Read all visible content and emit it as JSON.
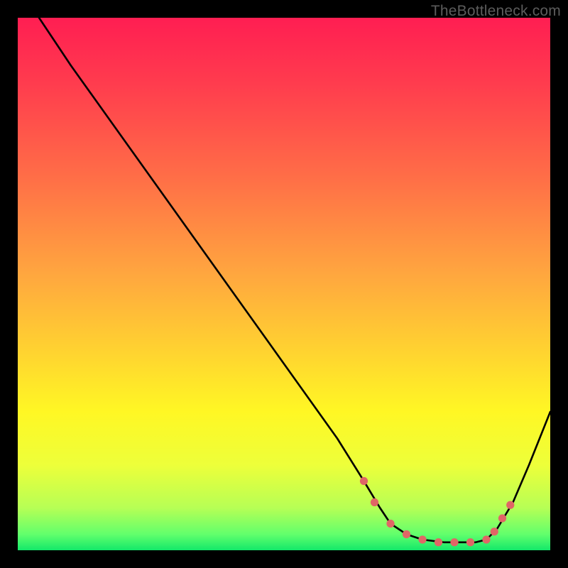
{
  "watermark": "TheBottleneck.com",
  "gradient_stops": [
    {
      "offset": "0%",
      "color": "#ff1e52"
    },
    {
      "offset": "12%",
      "color": "#ff3b4e"
    },
    {
      "offset": "30%",
      "color": "#ff6e47"
    },
    {
      "offset": "48%",
      "color": "#ffa63f"
    },
    {
      "offset": "62%",
      "color": "#ffd131"
    },
    {
      "offset": "74%",
      "color": "#fff724"
    },
    {
      "offset": "84%",
      "color": "#edff3a"
    },
    {
      "offset": "92%",
      "color": "#b7ff55"
    },
    {
      "offset": "97%",
      "color": "#62ff6c"
    },
    {
      "offset": "100%",
      "color": "#13e86a"
    }
  ],
  "chart_data": {
    "type": "line",
    "title": "",
    "xlabel": "",
    "ylabel": "",
    "xlim": [
      0,
      100
    ],
    "ylim": [
      0,
      100
    ],
    "series": [
      {
        "name": "bottleneck-curve",
        "x": [
          4,
          10,
          20,
          30,
          40,
          50,
          60,
          65,
          68,
          70,
          73,
          76,
          80,
          83,
          86,
          88,
          90,
          93,
          96,
          100
        ],
        "y": [
          100,
          91,
          77,
          63,
          49,
          35,
          21,
          13,
          8,
          5,
          3,
          2,
          1.5,
          1.5,
          1.5,
          2,
          4,
          9,
          16,
          26
        ]
      }
    ],
    "markers": {
      "name": "highlight-dots",
      "color": "#e06666",
      "points": [
        {
          "x": 65,
          "y": 13
        },
        {
          "x": 67,
          "y": 9
        },
        {
          "x": 70,
          "y": 5
        },
        {
          "x": 73,
          "y": 3
        },
        {
          "x": 76,
          "y": 2
        },
        {
          "x": 79,
          "y": 1.5
        },
        {
          "x": 82,
          "y": 1.5
        },
        {
          "x": 85,
          "y": 1.5
        },
        {
          "x": 88,
          "y": 2
        },
        {
          "x": 89.5,
          "y": 3.5
        },
        {
          "x": 91,
          "y": 6
        },
        {
          "x": 92.5,
          "y": 8.5
        }
      ]
    }
  }
}
